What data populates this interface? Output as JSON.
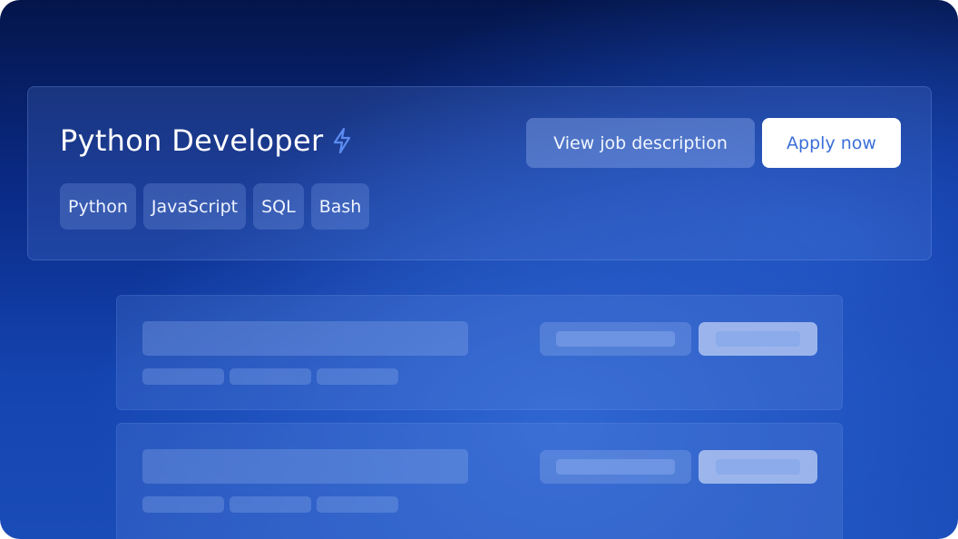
{
  "job": {
    "title": "Python Developer",
    "title_icon": "lightning-bolt-icon",
    "tags": [
      "Python",
      "JavaScript",
      "SQL",
      "Bash"
    ],
    "view_label": "View job description",
    "apply_label": "Apply now"
  },
  "colors": {
    "accent": "#3b6fd8",
    "bolt": "#5b8cf0"
  }
}
